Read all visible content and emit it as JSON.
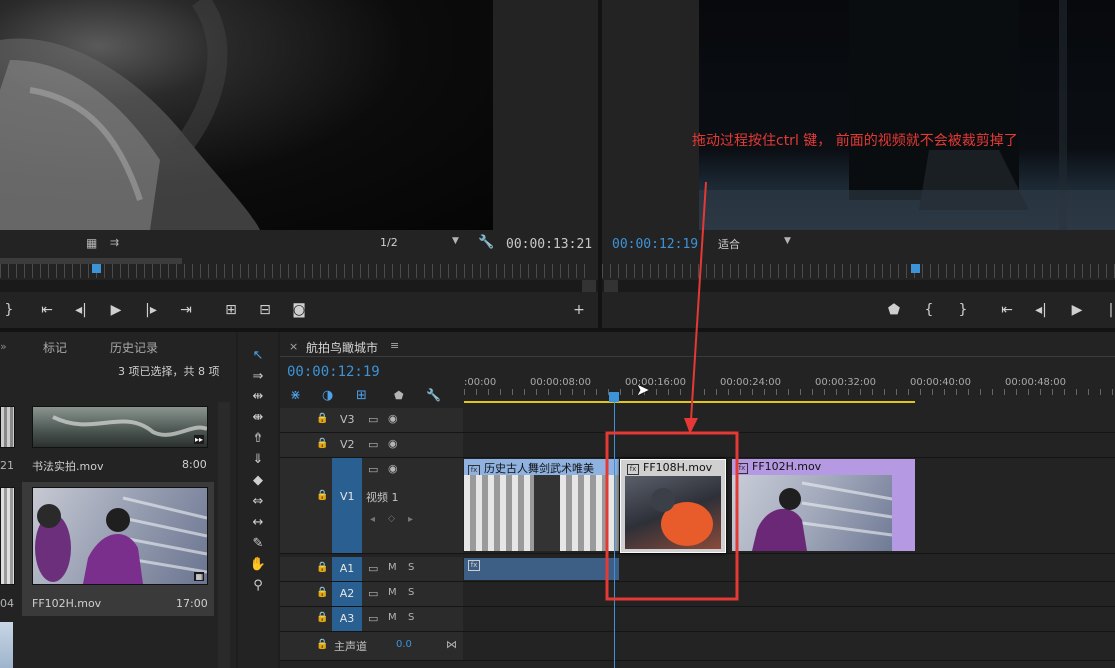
{
  "source_monitor": {
    "timecode": "00:00:13:21",
    "resolution": "1/2"
  },
  "program_monitor": {
    "timecode": "00:00:12:19",
    "fit": "适合"
  },
  "annotation": {
    "text": "拖动过程按住ctrl 键， 前面的视频就不会被裁剪掉了",
    "color": "#e53935"
  },
  "project_panel": {
    "tabs": [
      "标记",
      "历史记录"
    ],
    "selection_status": "3 项已选择，共 8 项",
    "items": [
      {
        "name": "书法实拍.mov",
        "duration": "8:00",
        "left_duration": "21"
      },
      {
        "name": "FF102H.mov",
        "duration": "17:00",
        "left_duration": "04"
      }
    ]
  },
  "timeline": {
    "sequence_name": "航拍鸟瞰城市",
    "timecode": "00:00:12:19",
    "ruler_labels": [
      ":00:00",
      "00:00:08:00",
      "00:00:16:00",
      "00:00:24:00",
      "00:00:32:00",
      "00:00:40:00",
      "00:00:48:00"
    ],
    "video_tracks": [
      {
        "id": "V3"
      },
      {
        "id": "V2"
      },
      {
        "id": "V1",
        "label": "视频 1"
      }
    ],
    "audio_tracks": [
      {
        "id": "A1",
        "m": "M",
        "s": "S"
      },
      {
        "id": "A2",
        "m": "M",
        "s": "S"
      },
      {
        "id": "A3",
        "m": "M",
        "s": "S"
      }
    ],
    "master": {
      "label": "主声道",
      "value": "0.0"
    },
    "clips": [
      {
        "title": "历史古人舞剑武术唯美"
      },
      {
        "title": "FF108H.mov"
      },
      {
        "title": "FF102H.mov"
      }
    ]
  },
  "colors": {
    "accent_blue": "#3d93d8",
    "clip_video": "#8fb2e0",
    "clip_purple": "#b59ae3",
    "highlight_red": "#e53935"
  }
}
